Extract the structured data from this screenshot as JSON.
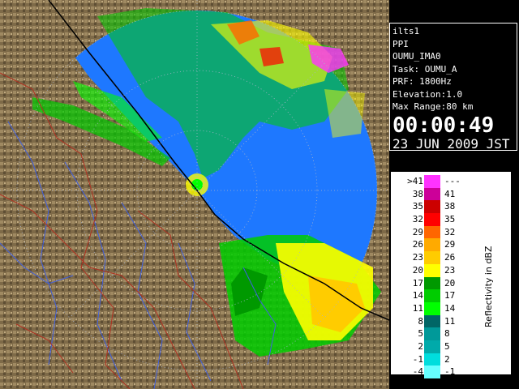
{
  "info": {
    "station": "ilts1",
    "scan_mode": "PPI",
    "product": "OUMU_IMA0",
    "task": "Task: OUMU_A",
    "prf": "PRF: 1800Hz",
    "elevation": "Elevation:1.0",
    "max_range": "Max Range:80 km",
    "time": "00:00:49",
    "date": "23 JUN 2009 JST"
  },
  "legend": {
    "title": "Reflectivity in dBZ",
    "rows": [
      {
        "lo": ">41",
        "hi": "---",
        "color": "#ff33ff"
      },
      {
        "lo": "38",
        "hi": "41",
        "color": "#cc0099"
      },
      {
        "lo": "35",
        "hi": "38",
        "color": "#cc0000"
      },
      {
        "lo": "32",
        "hi": "35",
        "color": "#ff0000"
      },
      {
        "lo": "29",
        "hi": "32",
        "color": "#ff6600"
      },
      {
        "lo": "26",
        "hi": "29",
        "color": "#ffaa00"
      },
      {
        "lo": "23",
        "hi": "26",
        "color": "#ffcc00"
      },
      {
        "lo": "20",
        "hi": "23",
        "color": "#ffff00"
      },
      {
        "lo": "17",
        "hi": "20",
        "color": "#009900"
      },
      {
        "lo": "14",
        "hi": "17",
        "color": "#00cc00"
      },
      {
        "lo": "11",
        "hi": "14",
        "color": "#00ff00"
      },
      {
        "lo": "8",
        "hi": "11",
        "color": "#006666"
      },
      {
        "lo": "5",
        "hi": "8",
        "color": "#009999"
      },
      {
        "lo": "2",
        "hi": "5",
        "color": "#00aaaa"
      },
      {
        "lo": "-1",
        "hi": "2",
        "color": "#00dddd"
      },
      {
        "lo": "-4",
        "hi": "-1",
        "color": "#66ffff"
      }
    ]
  },
  "colors": {
    "range_disc": "#1e78ff",
    "terrain": "#8a7652",
    "river": "#4060e0",
    "boundary": "#a03020",
    "range_ring": "#9aa6c0"
  }
}
